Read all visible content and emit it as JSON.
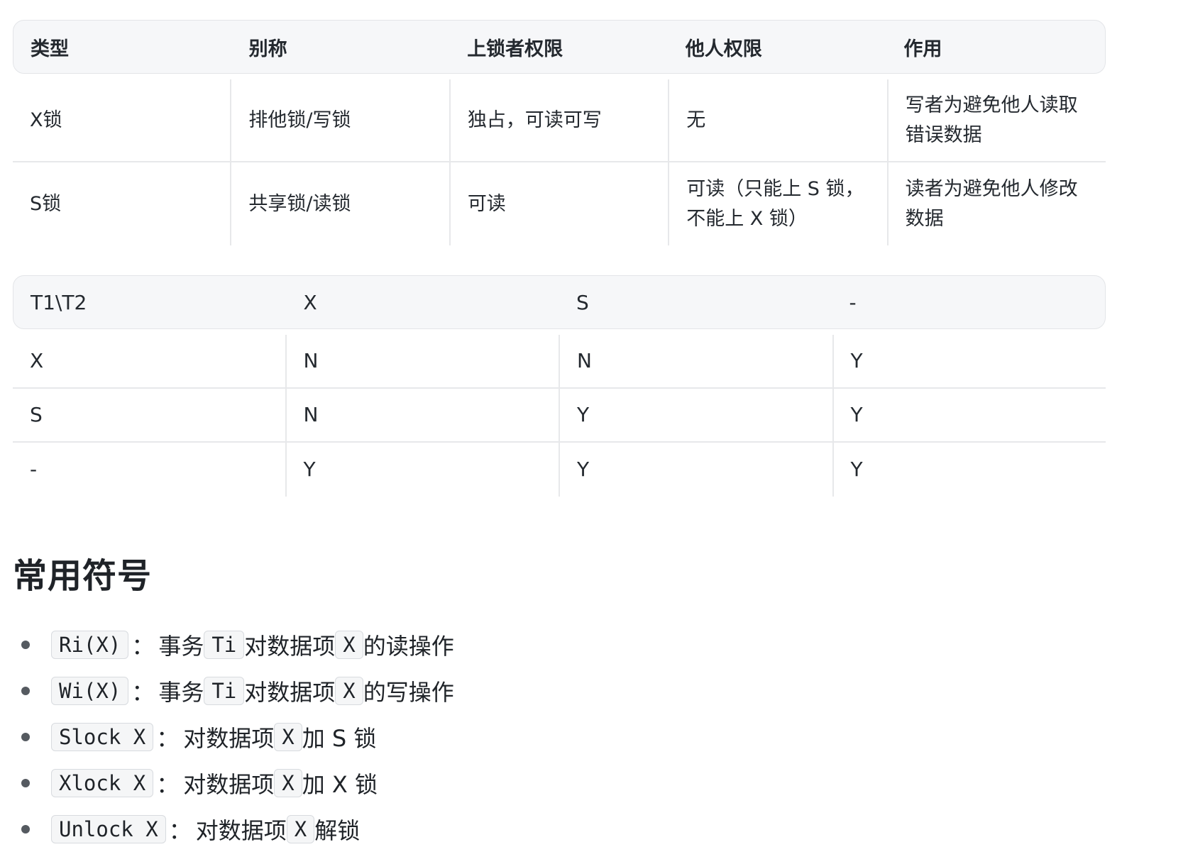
{
  "lock_types_table": {
    "headers": [
      "类型",
      "别称",
      "上锁者权限",
      "他人权限",
      "作用"
    ],
    "rows": [
      [
        "X锁",
        "排他锁/写锁",
        "独占，可读可写",
        "无",
        "写者为避免他人读取错误数据"
      ],
      [
        "S锁",
        "共享锁/读锁",
        "可读",
        "可读（只能上 S 锁，不能上 X 锁）",
        "读者为避免他人修改数据"
      ]
    ]
  },
  "compat_table": {
    "headers": [
      "T1\\T2",
      "X",
      "S",
      "-"
    ],
    "rows": [
      [
        "X",
        "N",
        "N",
        "Y"
      ],
      [
        "S",
        "N",
        "Y",
        "Y"
      ],
      [
        "-",
        "Y",
        "Y",
        "Y"
      ]
    ]
  },
  "section": {
    "title": "常用符号",
    "items": [
      {
        "code": "Ri(X)",
        "sep": "：",
        "t1": "事务",
        "c2": "Ti",
        "t2": "对数据项",
        "c3": "X",
        "t3": "的读操作"
      },
      {
        "code": "Wi(X)",
        "sep": "：",
        "t1": "事务",
        "c2": "Ti",
        "t2": "对数据项",
        "c3": "X",
        "t3": "的写操作"
      },
      {
        "code": "Slock X",
        "sep": "：",
        "t1": "对数据项",
        "c2": "X",
        "t2": "加 S 锁",
        "c3": "",
        "t3": ""
      },
      {
        "code": "Xlock X",
        "sep": "：",
        "t1": "对数据项",
        "c2": "X",
        "t2": "加 X 锁",
        "c3": "",
        "t3": ""
      },
      {
        "code": "Unlock X",
        "sep": "：",
        "t1": "对数据项",
        "c2": "X",
        "t2": "解锁",
        "c3": "",
        "t3": ""
      }
    ]
  }
}
